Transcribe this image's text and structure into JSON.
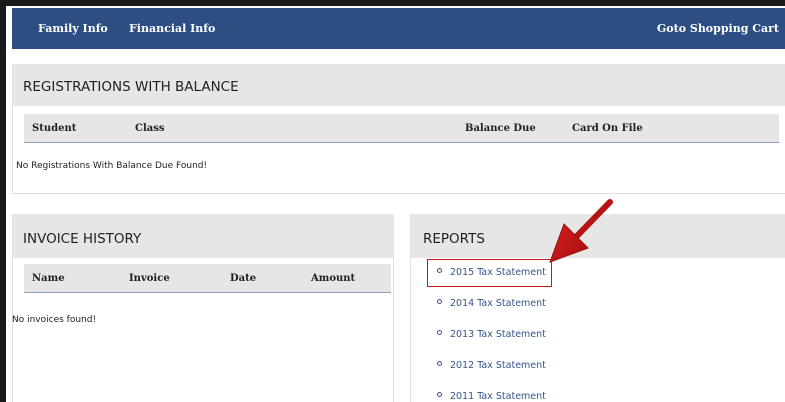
{
  "topnav": {
    "family_info": "Family Info",
    "financial_info": "Financial Info",
    "cart": "Goto Shopping Cart"
  },
  "registrations": {
    "title": "REGISTRATIONS WITH BALANCE",
    "columns": [
      "Student",
      "Class",
      "Balance Due",
      "Card On File"
    ],
    "empty_message": "No Registrations With Balance Due Found!"
  },
  "invoices": {
    "title": "INVOICE HISTORY",
    "columns": [
      "Name",
      "Invoice",
      "Date",
      "Amount"
    ],
    "empty_message": "No invoices found!"
  },
  "reports": {
    "title": "REPORTS",
    "items": [
      "2015 Tax Statement",
      "2014 Tax Statement",
      "2013 Tax Statement",
      "2012 Tax Statement",
      "2011 Tax Statement"
    ]
  },
  "annotation": {
    "highlight_color": "#cc1a1a",
    "highlighted_item": "2015 Tax Statement"
  }
}
